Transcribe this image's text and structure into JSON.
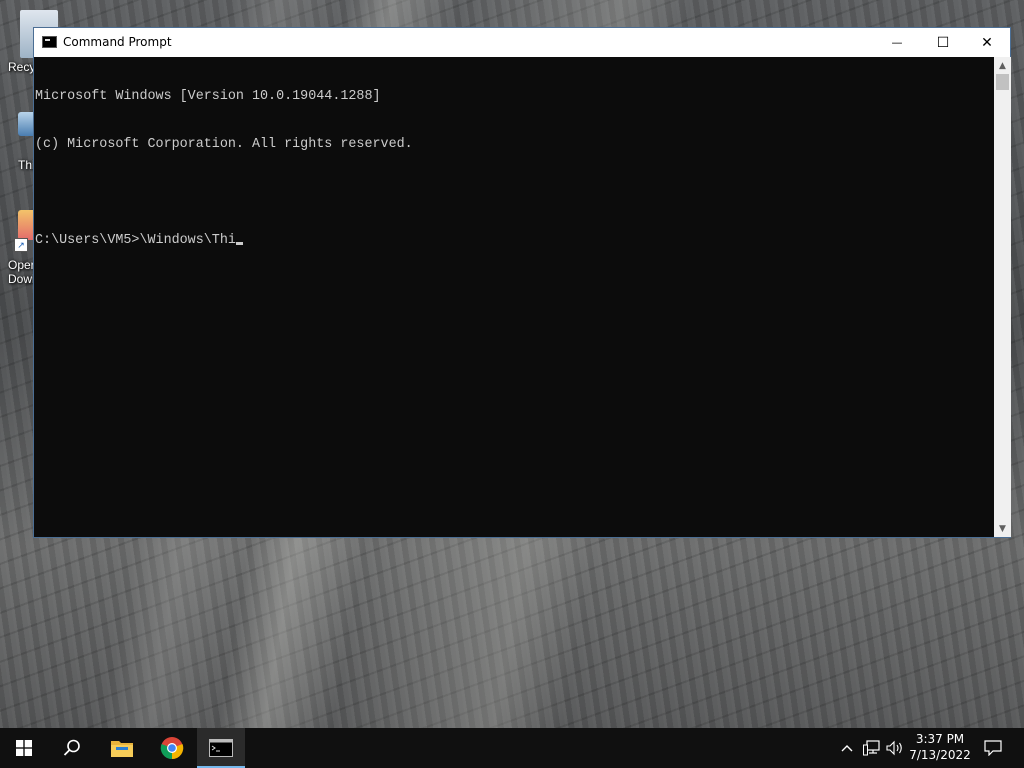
{
  "desktop": {
    "icons": [
      {
        "label": "Recy",
        "icon": "recycle-bin-icon"
      },
      {
        "label": "Thi",
        "icon": "this-pc-icon"
      },
      {
        "label": "Oper",
        "label2": "Dowi",
        "icon": "shortcut-file-icon"
      }
    ]
  },
  "window": {
    "title": "Command Prompt",
    "icon": "cmd-app-icon",
    "buttons": {
      "minimize": "—",
      "maximize": "☐",
      "close": "✕"
    },
    "console_lines": [
      "Microsoft Windows [Version 10.0.19044.1288]",
      "(c) Microsoft Corporation. All rights reserved.",
      "",
      "C:\\Users\\VM5>\\Windows\\Thi"
    ],
    "scroll": {
      "up": "▲",
      "down": "▼"
    }
  },
  "taskbar": {
    "pinned": [
      {
        "name": "start",
        "icon": "windows-logo-icon"
      },
      {
        "name": "search",
        "icon": "search-icon"
      },
      {
        "name": "file-explorer",
        "icon": "folder-icon"
      },
      {
        "name": "chrome",
        "icon": "chrome-icon"
      },
      {
        "name": "command-prompt",
        "icon": "cmd-app-icon",
        "active": true
      }
    ],
    "tray": {
      "chevron": "^",
      "time": "3:37 PM",
      "date": "7/13/2022"
    }
  }
}
